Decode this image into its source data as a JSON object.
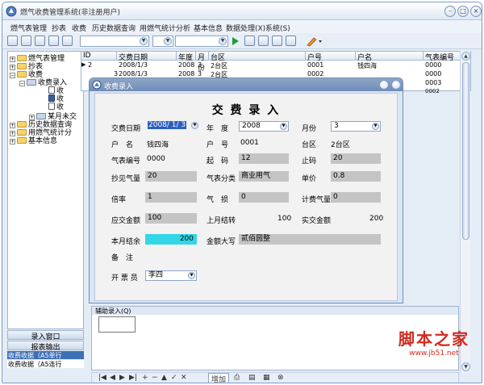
{
  "window": {
    "title": "燃气收费管理系统(非注册用户)",
    "minimize": "–",
    "maximize": "□",
    "close": "×"
  },
  "menu": [
    "燃气表管理",
    "抄表",
    "收费",
    "历史数据查询",
    "用燃气统计分析",
    "基本信息",
    "数据处理(X)",
    "系统(S)"
  ],
  "toolbar": {
    "combo1_value": "",
    "combo2_value": "",
    "combo3_value": ""
  },
  "tree": {
    "items": [
      {
        "label": "燃气表管理",
        "expander": "+"
      },
      {
        "label": "抄表",
        "expander": "+"
      },
      {
        "label": "收费",
        "expander": "−"
      },
      {
        "label": "收费录入",
        "expander": "−"
      },
      {
        "label": "收",
        "expander": ""
      },
      {
        "label": "收",
        "expander": ""
      },
      {
        "label": "收",
        "expander": ""
      },
      {
        "label": "某月未交",
        "expander": "+"
      },
      {
        "label": "历史数据查询",
        "expander": "+"
      },
      {
        "label": "用燃气统计分",
        "expander": "+"
      },
      {
        "label": "基本信息",
        "expander": "+"
      }
    ]
  },
  "left_bottom": {
    "header1": "录入窗口",
    "header2": "报表输出",
    "items": [
      "收费收据（A5单行",
      "收费收据（A5连行"
    ]
  },
  "grid": {
    "columns": [
      "ID",
      "交费日期",
      "年度",
      "月份",
      "台区",
      "户号",
      "户名",
      "气表编号"
    ],
    "rows": [
      [
        "2",
        "2008/1/3",
        "2008",
        "3",
        "2台区",
        "0001",
        "钱四海",
        "0000"
      ],
      [
        "3",
        "2008/1/3",
        "2008",
        "3",
        "2台区",
        "0002",
        "",
        "0000"
      ],
      [
        "",
        "",
        "",
        "",
        "",
        "",
        "",
        "0003"
      ],
      [
        "",
        "",
        "",
        "",
        "",
        "",
        "",
        "0002"
      ]
    ]
  },
  "dialog": {
    "title": "收费录入",
    "heading": "交 费 录 入",
    "fields": {
      "date_label": "交费日期",
      "date_value": "2008/ 1/ 3",
      "year_label": "年　度",
      "year_value": "2008",
      "month_label": "月份",
      "month_value": "3",
      "name_label": "户　名",
      "name_value": "钱四海",
      "account_label": "户　号",
      "account_value": "0001",
      "area_label": "台区",
      "area_value": "2台区",
      "meter_label": "气表编号",
      "meter_value": "0000",
      "start_label": "起　码",
      "start_value": "12",
      "end_label": "止码",
      "end_value": "20",
      "reading_label": "抄见气量",
      "reading_value": "20",
      "category_label": "气表分类",
      "category_value": "商业用气",
      "price_label": "单价",
      "price_value": "0.8",
      "multiplier_label": "倍率",
      "multiplier_value": "1",
      "loss_label": "气　损",
      "loss_value": "0",
      "billed_label": "计费气量",
      "billed_value": "0",
      "due_label": "应交金额",
      "due_value": "100",
      "carry_label": "上月结转",
      "carry_value": "100",
      "paid_label": "实交金额",
      "paid_value": "200",
      "balance_label": "本月结余",
      "balance_value": "200",
      "uppercase_label": "金额大写",
      "uppercase_value": "贰佰圆整",
      "remark_label": "备　注",
      "issuer_label": "开 票 员",
      "issuer_value": "李四"
    }
  },
  "aux_panel": {
    "title": "辅助录入(Q)"
  },
  "nav": {
    "add_label": "增加"
  },
  "watermark": {
    "line1": "脚本之家",
    "line2": "www.jb51.net"
  },
  "colors": {
    "balance_highlight": "#33d6e6",
    "field_gray": "#c4c4c4",
    "watermark": "#d22a1e"
  }
}
